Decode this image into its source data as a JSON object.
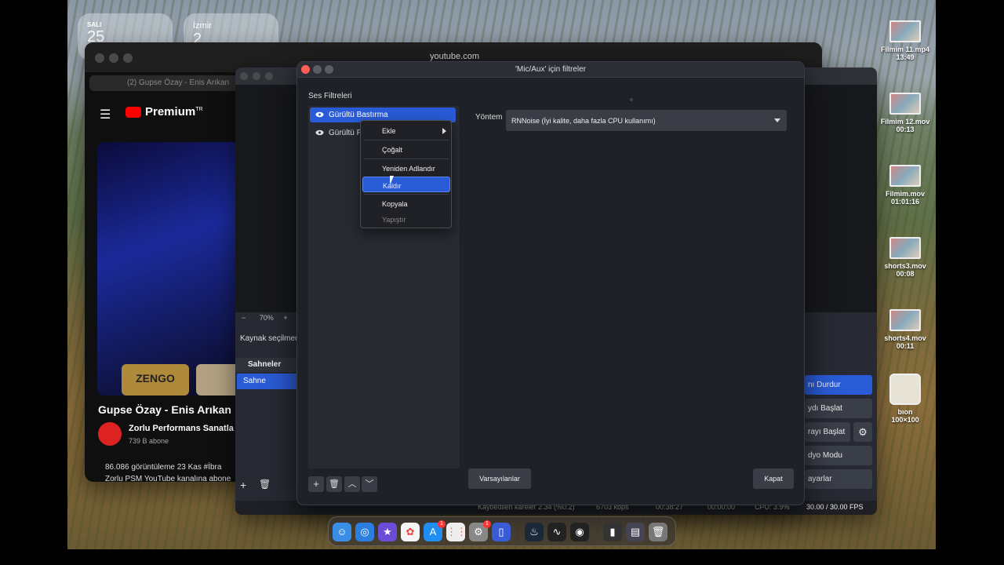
{
  "widgets": {
    "calendar": {
      "day": "SALI",
      "date": "25"
    },
    "weather": {
      "city": "İzmir",
      "temp": "2"
    }
  },
  "browser": {
    "url": "youtube.com",
    "tab_title": "(2) Gupse Özay - Enis Arıkan",
    "brand": "Premium",
    "brand_sup": "TR",
    "thumb1": "ZENGO",
    "video_title": "Gupse Özay - Enis Arıkan",
    "channel": "Zorlu Performans Sanatla",
    "subscribers": "739 B abone",
    "views_line": "86.086 görüntüleme  23 Kas  #İbra",
    "desc_line": "Zorlu PSM YouTube kanalına abone"
  },
  "obs": {
    "zoom_minus": "−",
    "zoom": "70%",
    "zoom_plus": "+",
    "source_bar": "Kaynak seçilmedi",
    "scenes_header": "Sahneler",
    "scene": "Sahne",
    "controls": [
      "nı Durdur",
      "ydı Başlat",
      "rayı Başlat",
      "dyo Modu",
      "ayarlar"
    ],
    "status": {
      "dropped": "Kaybedilen kareler 2.34 (%0.2)",
      "kbps": "6703 kbps",
      "time1": "00:38:27",
      "time2": "00:00:00",
      "cpu": "CPU: 3.9%",
      "fps": "30.00 / 30.00 FPS"
    }
  },
  "dialog": {
    "title": "'Mic/Aux' için filtreler",
    "section_label": "Ses Filtreleri",
    "filters": [
      "Gürültü Bastırma",
      "Gürültü F"
    ],
    "method_label": "Yöntem",
    "method_value": "RNNoise (İyi kalite, daha fazla CPU kullanımı)",
    "defaults_button": "Varsayılanlar",
    "close_button": "Kapat"
  },
  "context_menu": {
    "items": [
      "Ekle",
      "Çoğalt",
      "Yeniden Adlandır",
      "Kaldır",
      "Kopyala",
      "Yapıştır"
    ]
  },
  "desktop_files": [
    {
      "name": "Filmim 11.mp4",
      "meta": "13:49"
    },
    {
      "name": "Filmim 12.mov",
      "meta": "00:13"
    },
    {
      "name": "Filmim.mov",
      "meta": "01:01:16"
    },
    {
      "name": "shorts3.mov",
      "meta": "00:08"
    },
    {
      "name": "shorts4.mov",
      "meta": "00:11"
    },
    {
      "name": "bıon",
      "meta": "100×100"
    }
  ],
  "dock": {
    "badge_appstore": "1",
    "badge_settings": "1"
  }
}
